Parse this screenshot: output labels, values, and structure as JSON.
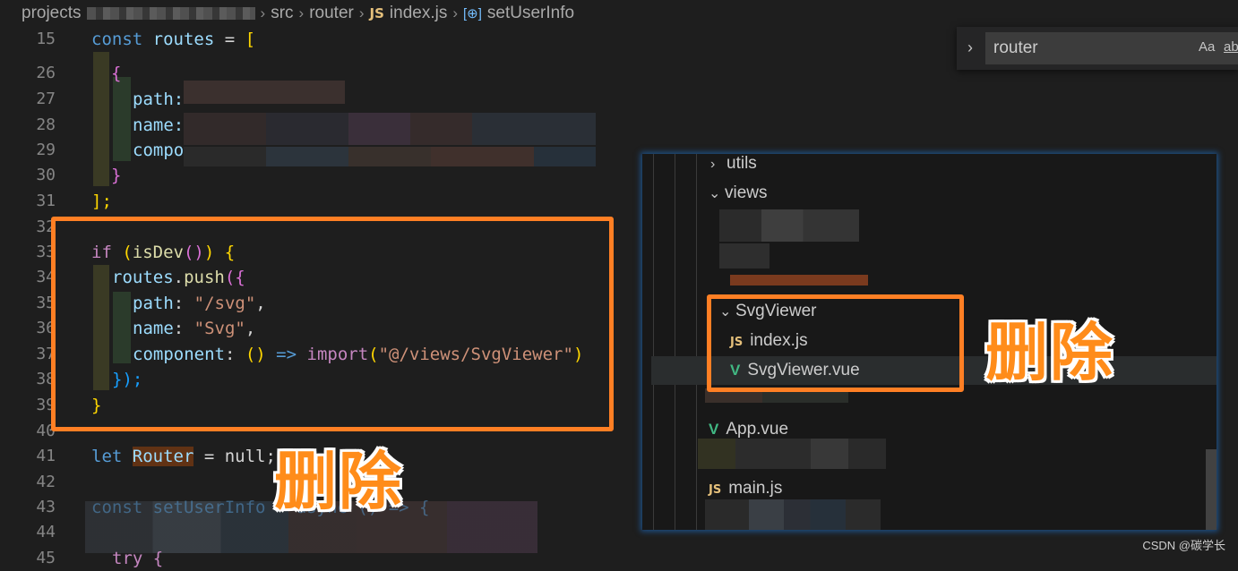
{
  "breadcrumb": {
    "items": [
      {
        "label": "projects"
      },
      {
        "label": "src"
      },
      {
        "label": "router"
      },
      {
        "label": "index.js",
        "icon": "JS"
      },
      {
        "label": "setUserInfo",
        "icon": "[⊕]"
      }
    ]
  },
  "editor": {
    "line_numbers": [
      "15",
      "26",
      "27",
      "28",
      "29",
      "30",
      "31",
      "32",
      "33",
      "34",
      "35",
      "36",
      "37",
      "38",
      "39",
      "40",
      "41",
      "42",
      "43",
      "44",
      "45"
    ],
    "code": {
      "l15_kw": "const",
      "l15_var": "routes",
      "l15_rest": " = ",
      "l15_br": "[",
      "l26_br": "{",
      "l27": "path:",
      "l28": "name:",
      "l29": "compo",
      "l30_br": "}",
      "l31": "];",
      "l33_kw": "if",
      "l33_p1": " (",
      "l33_fn": "isDev",
      "l33_p2": "()",
      "l33_p3": ") ",
      "l33_br": "{",
      "l34_var": "routes",
      "l34_dot": ".",
      "l34_fn": "push",
      "l34_br": "({",
      "l35_key": "path",
      "l35_col": ": ",
      "l35_str": "\"/svg\"",
      "l35_end": ",",
      "l36_key": "name",
      "l36_col": ": ",
      "l36_str": "\"Svg\"",
      "l36_end": ",",
      "l37_key": "component",
      "l37_col": ": ",
      "l37_p": "() ",
      "l37_arrow": "=> ",
      "l37_imp": "import",
      "l37_po": "(",
      "l37_str": "\"@/views/SvgViewer\"",
      "l37_pc": ")",
      "l38_br": "});",
      "l39_br": "}",
      "l41_kw": "let",
      "l41_var": "Router",
      "l41_rest": " = null;",
      "l43": "const setUserInfo = async () => {",
      "l45": "try {"
    }
  },
  "find": {
    "value": "router",
    "aa_label": "Aa",
    "ab_label": "ab"
  },
  "explorer": {
    "items": [
      {
        "label": "utils",
        "chevron": "›"
      },
      {
        "label": "views",
        "chevron": "⌄"
      },
      {
        "label": "SvgViewer",
        "chevron": "⌄"
      },
      {
        "label": "index.js",
        "icon": "JS"
      },
      {
        "label": "SvgViewer.vue",
        "icon": "V"
      },
      {
        "label": "App.vue",
        "icon": "V"
      },
      {
        "label": "main.js",
        "icon": "JS"
      }
    ]
  },
  "annotations": {
    "delete_label_code": "删除",
    "delete_label_tree": "删除"
  },
  "watermark": "CSDN @碳学长",
  "colors": {
    "highlight": "#ff7f24",
    "label": "#ff8c1a",
    "background": "#1e1e1e"
  }
}
